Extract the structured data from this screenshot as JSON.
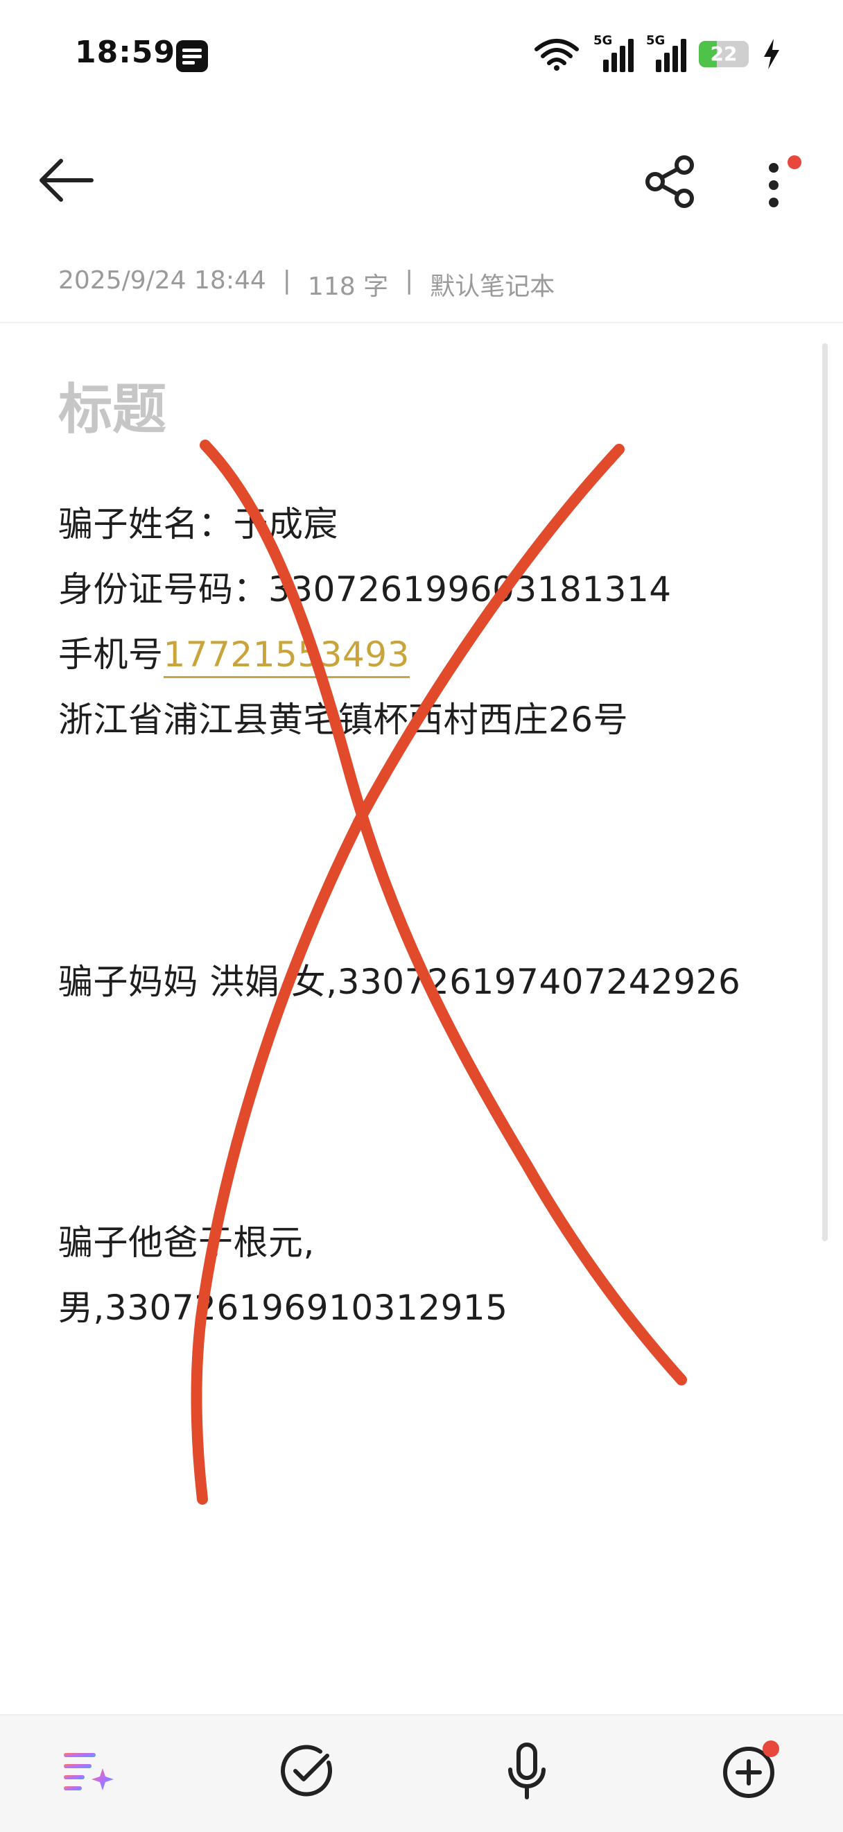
{
  "status_bar": {
    "time": "18:59",
    "network_1": "5G",
    "network_2": "5G",
    "battery_level": "22",
    "battery_fraction": 0.22,
    "icons": [
      "app-notification-icon",
      "wifi-icon",
      "signal-icon",
      "signal-icon",
      "battery-icon",
      "charging-icon"
    ]
  },
  "toolbar": {
    "icons": [
      "back-arrow-icon",
      "share-icon",
      "more-vertical-icon"
    ]
  },
  "meta": {
    "date": "2025/9/24 18:44",
    "separator": "|",
    "word_count": "118 字",
    "notebook": "默认笔记本"
  },
  "note": {
    "title_placeholder": "标题",
    "line1": "骗子姓名：于成宸",
    "line2": "身份证号码：330726199603181314",
    "line3_label": "手机号",
    "line3_phone": "17721553493",
    "line4": "浙江省浦江县黄宅镇杯西村西庄26号",
    "line5": "骗子妈妈 洪娟,女,330726197407242926",
    "line6": "骗子他爸于根元,",
    "line7": "男,330726196910312915"
  },
  "bottom_bar": {
    "icons": [
      "ai-format-icon",
      "checklist-icon",
      "microphone-icon",
      "add-icon"
    ]
  },
  "colors": {
    "accent_link": "#c9a43a",
    "cross_mark": "#e24a2c",
    "notification_dot": "#e8473b",
    "battery_green": "#4fc24a"
  }
}
